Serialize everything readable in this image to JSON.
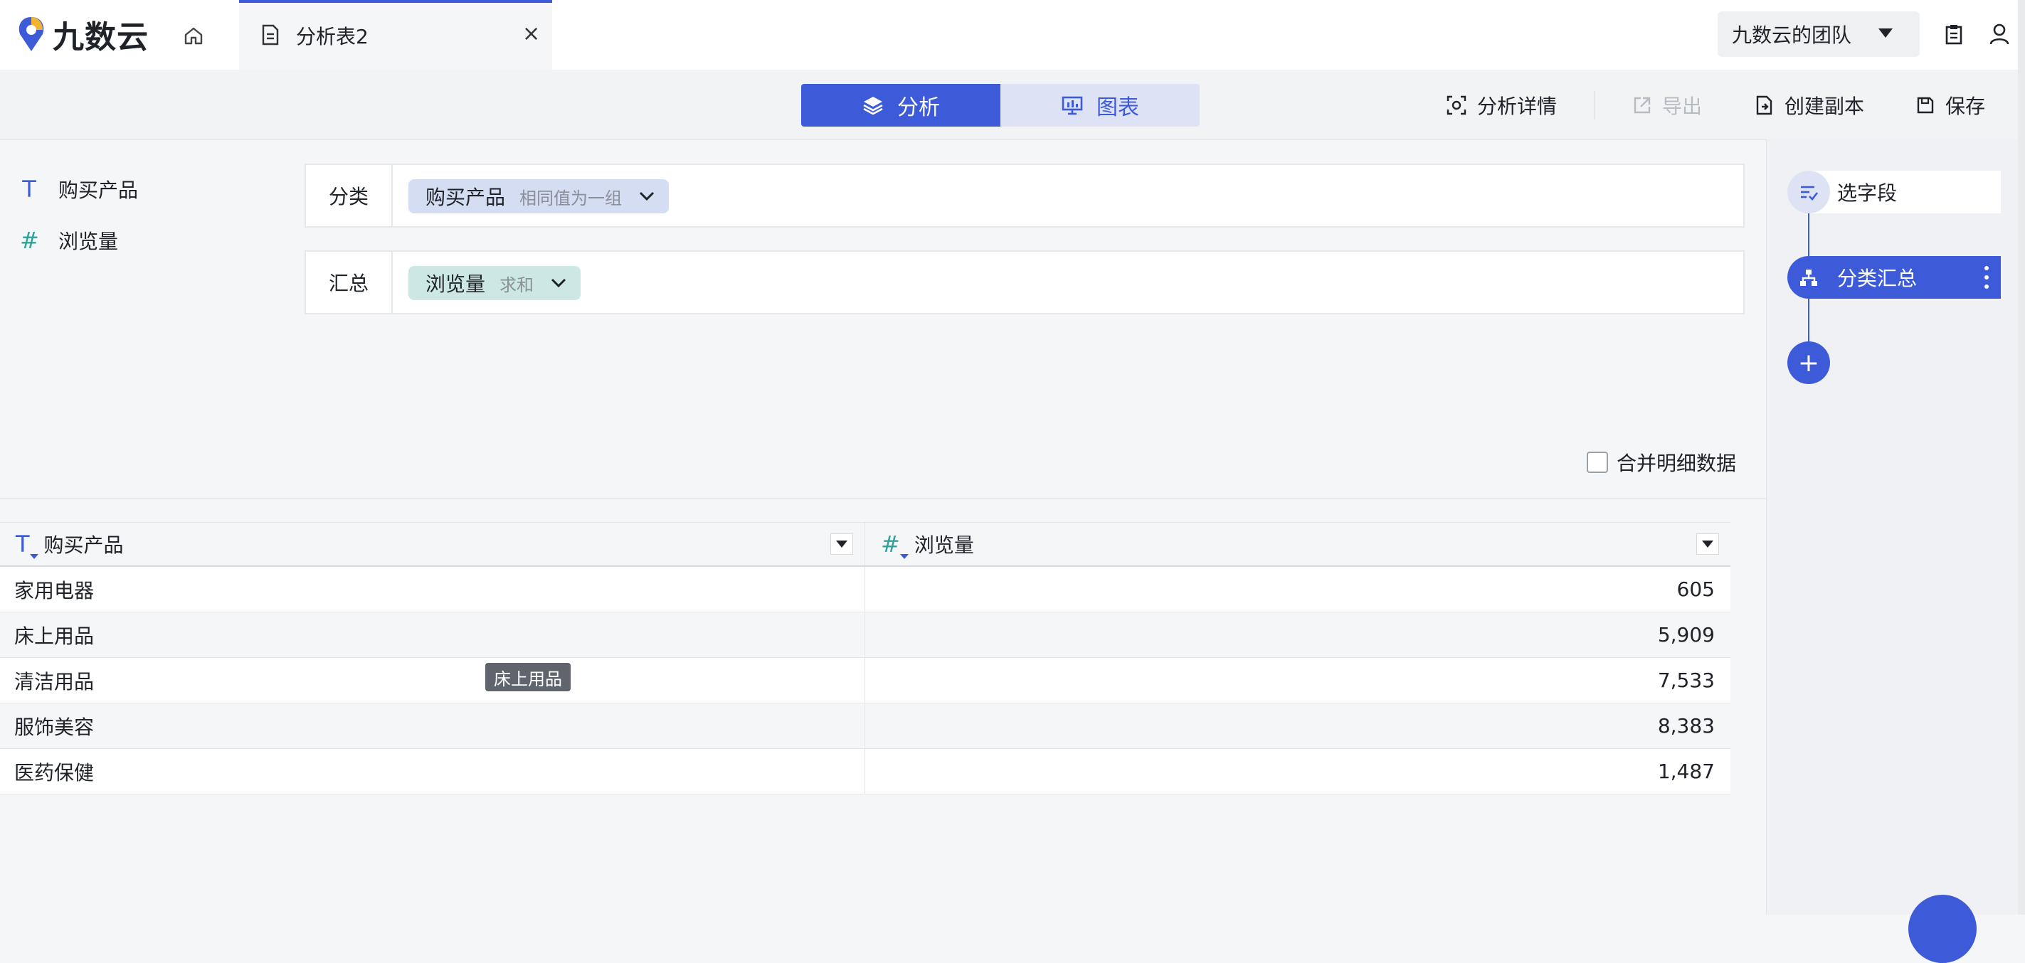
{
  "app": {
    "logo_text": "九数云",
    "active_tab": "分析表2",
    "tab_close": "×",
    "team_selector": "九数云的团队"
  },
  "toolbar": {
    "analyze_label": "分析",
    "chart_label": "图表",
    "details_label": "分析详情",
    "export_label": "导出",
    "copy_label": "创建副本",
    "save_label": "保存"
  },
  "fields": [
    {
      "icon": "text-type-icon",
      "glyph": "T",
      "name": "购买产品"
    },
    {
      "icon": "number-type-icon",
      "glyph": "#",
      "name": "浏览量"
    }
  ],
  "config": {
    "category_label": "分类",
    "category_field": "购买产品",
    "category_mode": "相同值为一组",
    "summary_label": "汇总",
    "summary_field": "浏览量",
    "summary_mode": "求和"
  },
  "merge_detail_label": "合并明细数据",
  "merge_detail_checked": false,
  "table": {
    "columns": [
      "购买产品",
      "浏览量"
    ],
    "rows": [
      [
        "家用电器",
        "605"
      ],
      [
        "床上用品",
        "5,909"
      ],
      [
        "清洁用品",
        "7,533"
      ],
      [
        "服饰美容",
        "8,383"
      ],
      [
        "医药保健",
        "1,487"
      ]
    ]
  },
  "tooltip_text": "床上用品",
  "pipeline": {
    "step1": "选字段",
    "step2": "分类汇总",
    "add": "+"
  },
  "colors": {
    "accent": "#3d5bd9",
    "text_type": "#3d5bd9",
    "number_type": "#2fa39a"
  }
}
